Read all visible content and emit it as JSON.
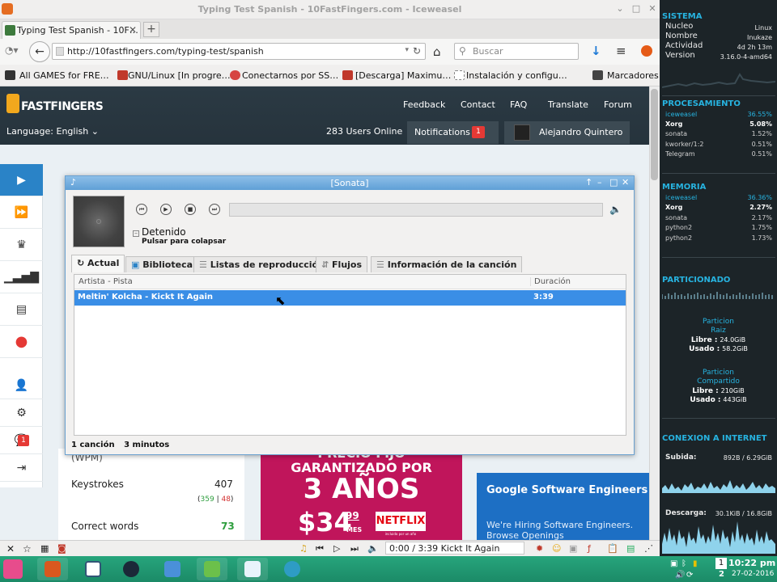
{
  "window": {
    "title": "Typing Test Spanish - 10FastFingers.com - Iceweasel",
    "controls": [
      "⌄",
      "□",
      "✕"
    ]
  },
  "tab": {
    "label": "Typing Test Spanish - 10F…",
    "close": "✕",
    "new": "+"
  },
  "nav": {
    "url": "http://10fastfingers.com/typing-test/spanish",
    "search_placeholder": "Buscar"
  },
  "bookmarks": [
    "All GAMES for FRE…",
    "GNU/Linux [In progre…",
    "Conectarnos por SS…",
    "[Descarga] Maximu…",
    "Instalación y configu…",
    "Marcadores"
  ],
  "site": {
    "logo": "FASTFINGERS",
    "nav": [
      "Feedback",
      "Contact",
      "FAQ",
      "Translate",
      "Forum"
    ],
    "language": "Language: English",
    "online": "283 Users Online",
    "notifications_label": "Notifications",
    "notifications_count": "1",
    "user_name": "Alejandro Quintero",
    "sidebar_badge": "1",
    "stats": {
      "wpm_label": "(WPM)",
      "keystrokes_label": "Keystrokes",
      "keystrokes_value": "407",
      "keystrokes_ok": "359",
      "keystrokes_sep": " | ",
      "keystrokes_bad": "48",
      "correct_label": "Correct words",
      "correct_value": "73"
    },
    "ad1": {
      "line1": "PRECIO FIJO",
      "line2": "GARANTIZADO POR",
      "line3": "3 AÑOS",
      "price": "$34",
      "cents": "99",
      "per": "MES",
      "brand": "NETFLIX",
      "fine": "incluido por un año"
    },
    "ad2": {
      "headline": "Google Software Engineers",
      "sub": "We're Hiring Software Engineers. Browse Openings"
    }
  },
  "addonbar": {
    "track": "0:00 / 3:39 Kickt It Again"
  },
  "sonata": {
    "title": "[Sonata]",
    "status": "Detenido",
    "hint": "Pulsar para colapsar",
    "tabs": [
      "Actual",
      "Biblioteca",
      "Listas de reproducción",
      "Flujos",
      "Información de la canción"
    ],
    "columns": {
      "track": "Artista - Pista",
      "duration": "Duración"
    },
    "rows": [
      {
        "track": "Meltin' Kolcha - Kickt It Again",
        "duration": "3:39"
      }
    ],
    "footer": {
      "songs": "1 canción",
      "minutes": "3 minutos"
    }
  },
  "conky": {
    "sistema": {
      "heading": "SISTEMA",
      "rows": [
        {
          "label": "Nucleo",
          "value": "Linux"
        },
        {
          "label": "Nombre",
          "value": "Inukaze"
        },
        {
          "label": "Actividad",
          "value": "4d 2h 13m"
        },
        {
          "label": "Version",
          "value": "3.16.0-4-amd64"
        }
      ]
    },
    "procesamiento": {
      "heading": "PROCESAMIENTO",
      "rows": [
        {
          "name": "iceweasel",
          "value": "36.55%"
        },
        {
          "name": "Xorg",
          "value": "5.08%"
        },
        {
          "name": "sonata",
          "value": "1.52%"
        },
        {
          "name": "kworker/1:2",
          "value": "0.51%"
        },
        {
          "name": "Telegram",
          "value": "0.51%"
        }
      ]
    },
    "memoria": {
      "heading": "MEMORIA",
      "rows": [
        {
          "name": "iceweasel",
          "value": "36.36%"
        },
        {
          "name": "Xorg",
          "value": "2.27%"
        },
        {
          "name": "sonata",
          "value": "2.17%"
        },
        {
          "name": "python2",
          "value": "1.75%"
        },
        {
          "name": "python2",
          "value": "1.73%"
        }
      ]
    },
    "particionado": {
      "heading": "PARTICIONADO",
      "raiz": {
        "name": "Particion",
        "name2": "Raiz",
        "libre_label": "Libre :",
        "libre": "24.0GiB",
        "usado_label": "Usado :",
        "usado": "58.2GiB"
      },
      "comp": {
        "name": "Particion",
        "name2": "Compartido",
        "libre_label": "Libre :",
        "libre": "210GiB",
        "usado_label": "Usado :",
        "usado": "443GiB"
      }
    },
    "red": {
      "heading": "CONEXION A INTERNET",
      "subida_label": "Subida:",
      "subida": "892B / 6.29GiB",
      "descarga_label": "Descarga:",
      "descarga": "30.1KiB / 16.8GiB"
    }
  },
  "taskbar": {
    "time": "10:22 pm",
    "date": "27-02-2016",
    "ws1": "1",
    "ws2": "2"
  },
  "colors": {
    "accent": "#2a83c7",
    "selection": "#3a8ee6",
    "conky_heading": "#27b3e0",
    "taskbar": "#1f9a73",
    "badge": "#e53935"
  }
}
